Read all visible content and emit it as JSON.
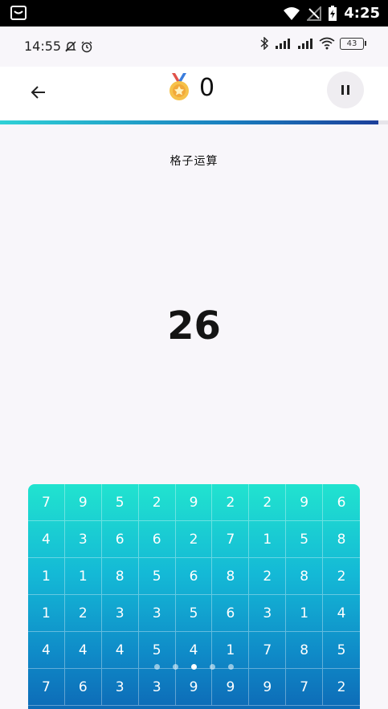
{
  "system_bar": {
    "time": "4:25",
    "icons": [
      "notification-app-icon",
      "wifi-icon",
      "no-signal-icon",
      "battery-charging-icon"
    ]
  },
  "phone_status": {
    "time": "14:55",
    "battery": "43",
    "icons": [
      "mute-icon",
      "alarm-icon",
      "bluetooth-icon",
      "signal-hd-icon",
      "signal-hd-icon",
      "wifi-icon"
    ]
  },
  "header": {
    "score": "0",
    "progress": 0.975,
    "medal_icon": "medal-icon"
  },
  "title": "格子运算",
  "target": "26",
  "grid": {
    "rows": [
      [
        "7",
        "9",
        "5",
        "2",
        "9",
        "2",
        "2",
        "9",
        "6"
      ],
      [
        "4",
        "3",
        "6",
        "6",
        "2",
        "7",
        "1",
        "5",
        "8"
      ],
      [
        "1",
        "1",
        "8",
        "5",
        "6",
        "8",
        "2",
        "8",
        "2"
      ],
      [
        "1",
        "2",
        "3",
        "3",
        "5",
        "6",
        "3",
        "1",
        "4"
      ],
      [
        "4",
        "4",
        "4",
        "5",
        "4",
        "1",
        "7",
        "8",
        "5"
      ],
      [
        "7",
        "6",
        "3",
        "3",
        "9",
        "9",
        "9",
        "7",
        "2"
      ]
    ]
  },
  "pager": {
    "count": 5,
    "active": 2
  },
  "colors": {
    "grid_top": "#21e3cf",
    "grid_bottom": "#0d6bb7",
    "progress_end": "#1c3f9a"
  }
}
